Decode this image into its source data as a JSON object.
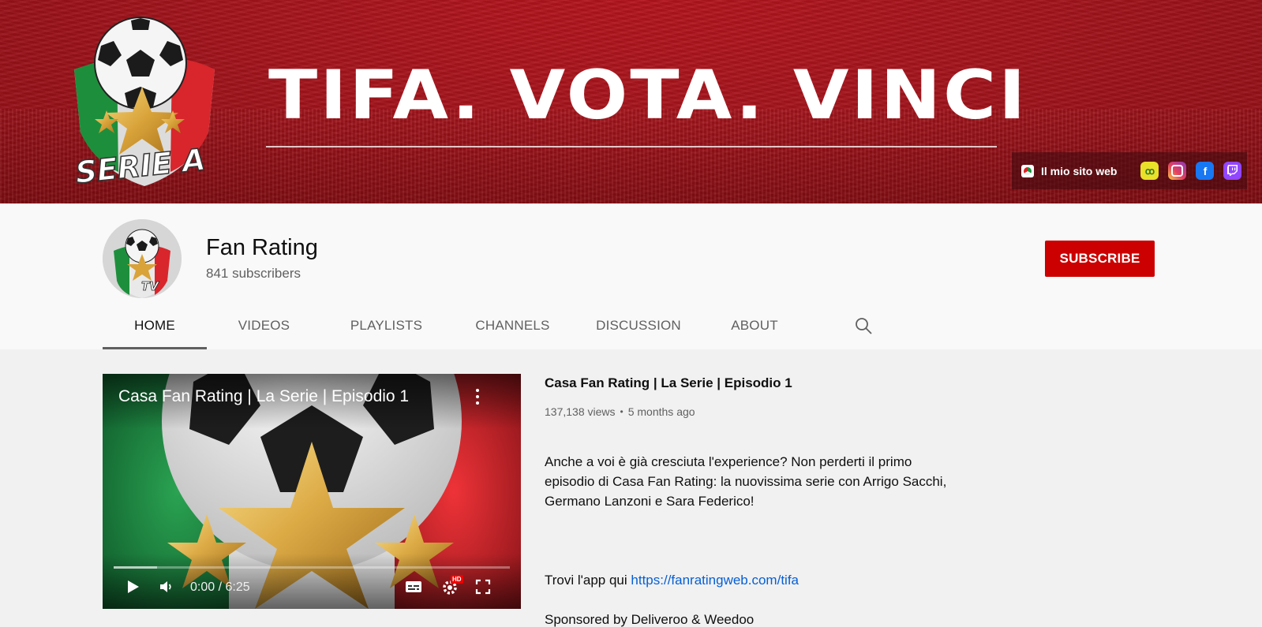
{
  "banner": {
    "headline": "TIFA. VOTA. VINCI",
    "logo_text": "SERIE A",
    "links": {
      "website_label": "Il mio sito web",
      "icons": [
        "weedoo-icon",
        "instagram-icon",
        "facebook-icon",
        "twitch-icon"
      ]
    }
  },
  "channel": {
    "name": "Fan Rating",
    "subscribers": "841 subscribers",
    "avatar_badge": "TV",
    "subscribe_label": "SUBSCRIBE"
  },
  "tabs": [
    {
      "label": "HOME",
      "active": true
    },
    {
      "label": "VIDEOS",
      "active": false
    },
    {
      "label": "PLAYLISTS",
      "active": false
    },
    {
      "label": "CHANNELS",
      "active": false
    },
    {
      "label": "DISCUSSION",
      "active": false
    },
    {
      "label": "ABOUT",
      "active": false
    }
  ],
  "featured": {
    "player_title": "Casa Fan Rating | La Serie | Episodio 1",
    "time_current": "0:00",
    "time_total": "6:25",
    "time_display": "0:00 / 6:25",
    "hd_badge": "HD",
    "title": "Casa Fan Rating | La Serie | Episodio 1",
    "views": "137,138 views",
    "age": "5 months ago",
    "description_line1": "Anche a voi è già cresciuta l'experience? Non perderti il  primo episodio di Casa Fan Rating: la nuovissima serie con Arrigo Sacchi, Germano Lanzoni e Sara Federico!",
    "description_app_prefix": "Trovi l'app qui ",
    "description_link": "https://fanratingweb.com/tifa",
    "description_sponsor": "Sponsored by Deliveroo & Weedoo"
  },
  "colors": {
    "banner_red": "#a5141c",
    "subscribe_red": "#cc0000",
    "link_blue": "#065fd4"
  }
}
